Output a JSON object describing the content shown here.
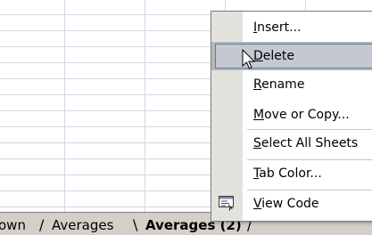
{
  "context_menu": {
    "items": [
      {
        "pre": "",
        "u": "I",
        "post": "nsert..."
      },
      {
        "pre": "",
        "u": "D",
        "post": "elete"
      },
      {
        "pre": "",
        "u": "R",
        "post": "ename"
      },
      {
        "pre": "",
        "u": "M",
        "post": "ove or Copy..."
      },
      {
        "pre": "",
        "u": "S",
        "post": "elect All Sheets"
      },
      {
        "pre": "",
        "u": "T",
        "post": "ab Color..."
      },
      {
        "pre": "",
        "u": "V",
        "post": "iew Code"
      }
    ],
    "highlighted_item": "Delete"
  },
  "sheet_tabs": {
    "partial_tab": "own",
    "tab_averages": "Averages",
    "tab_active": "Averages (2)",
    "separator": "/",
    "separator_back": "\\"
  },
  "icons": {
    "view_code": "view-code-icon",
    "cursor": "mouse-pointer-icon"
  },
  "colors": {
    "menu_highlight": "#b4b8c0",
    "menu_icon_strip": "#e3e3de",
    "gridline": "#d0d7e5",
    "tab_bar": "#d4d0c8"
  }
}
